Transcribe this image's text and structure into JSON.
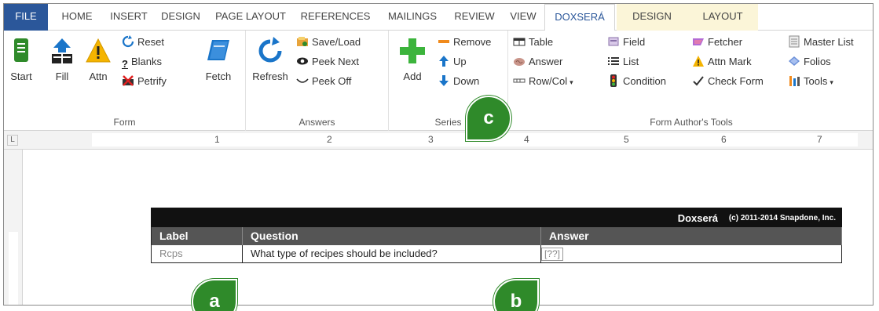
{
  "tabs": [
    {
      "id": "file",
      "label": "FILE"
    },
    {
      "id": "home",
      "label": "HOME"
    },
    {
      "id": "insert",
      "label": "INSERT"
    },
    {
      "id": "design",
      "label": "DESIGN"
    },
    {
      "id": "page-layout",
      "label": "PAGE LAYOUT"
    },
    {
      "id": "references",
      "label": "REFERENCES"
    },
    {
      "id": "mailings",
      "label": "MAILINGS"
    },
    {
      "id": "review",
      "label": "REVIEW"
    },
    {
      "id": "view",
      "label": "VIEW"
    },
    {
      "id": "doxsera",
      "label": "DOXSERÁ"
    },
    {
      "id": "design2",
      "label": "DESIGN"
    },
    {
      "id": "layout",
      "label": "LAYOUT"
    }
  ],
  "form": {
    "start": "Start",
    "fill": "Fill",
    "attn": "Attn",
    "reset": "Reset",
    "blanks": "Blanks",
    "petrify": "Petrify",
    "fetch": "Fetch",
    "label": "Form"
  },
  "answers": {
    "refresh": "Refresh",
    "save_load": "Save/Load",
    "peek_next": "Peek Next",
    "peek_off": "Peek Off",
    "label": "Answers"
  },
  "series": {
    "add": "Add",
    "remove": "Remove",
    "up": "Up",
    "down": "Down",
    "label": "Series"
  },
  "tools": {
    "table": "Table",
    "answer": "Answer",
    "row_col": "Row/Col",
    "field": "Field",
    "list": "List",
    "condition": "Condition",
    "fetcher": "Fetcher",
    "attn_mark": "Attn Mark",
    "check_form": "Check Form",
    "master_list": "Master List",
    "folios": "Folios",
    "tools": "Tools",
    "label": "Form Author's Tools"
  },
  "ruler": {
    "corner": "L",
    "marks": [
      "1",
      "2",
      "3",
      "4",
      "5",
      "6",
      "7"
    ]
  },
  "doc_table": {
    "brand": "Doxserá",
    "copyright": "(c) 2011-2014 Snapdone, Inc.",
    "headers": [
      "Label",
      "Question",
      "Answer"
    ],
    "row": {
      "label": "Rcps",
      "question": "What type of recipes should be included?",
      "answer": "[??]"
    }
  },
  "callouts": {
    "a": "a",
    "b": "b",
    "c": "c"
  },
  "colors": {
    "file_tab": "#2b579a",
    "header_black": "#111111",
    "header_gray": "#555555",
    "callout_green": "#2f8a2a"
  }
}
